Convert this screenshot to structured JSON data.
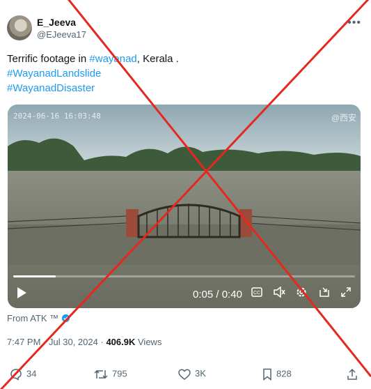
{
  "author": {
    "name": "E_Jeeva",
    "handle": "@EJeeva17",
    "more_label": "•••"
  },
  "tweet": {
    "text_prefix": "Terrific footage in ",
    "hashtag_1": "#wayanad",
    "text_suffix": ", Kerala .",
    "hashtag_2": "#WayanadLandslide",
    "hashtag_3": "#WayanadDisaster"
  },
  "video": {
    "camera_timestamp": "2024-06-16  16:03:48",
    "watermark": "@西安",
    "current_time": "0:05",
    "time_sep": " / ",
    "duration": "0:40",
    "progress": 0.125
  },
  "source": {
    "from_label": "From",
    "from_value": "ATK ™"
  },
  "meta": {
    "time": "7:47 PM",
    "date": "Jul 30, 2024",
    "separator": "·",
    "views_count": "406.9K",
    "views_label": "Views"
  },
  "actions": {
    "replies": "34",
    "reposts": "795",
    "likes": "3K",
    "bookmarks": "828"
  },
  "colors": {
    "link": "#1d9bf0",
    "cross": "#e5281f",
    "muted": "#536471"
  },
  "icons": [
    "play-icon",
    "captions-icon",
    "volume-icon",
    "settings-icon",
    "pip-icon",
    "fullscreen-icon",
    "reply-icon",
    "repost-icon",
    "like-icon",
    "bookmark-icon",
    "share-icon",
    "verified-icon"
  ]
}
